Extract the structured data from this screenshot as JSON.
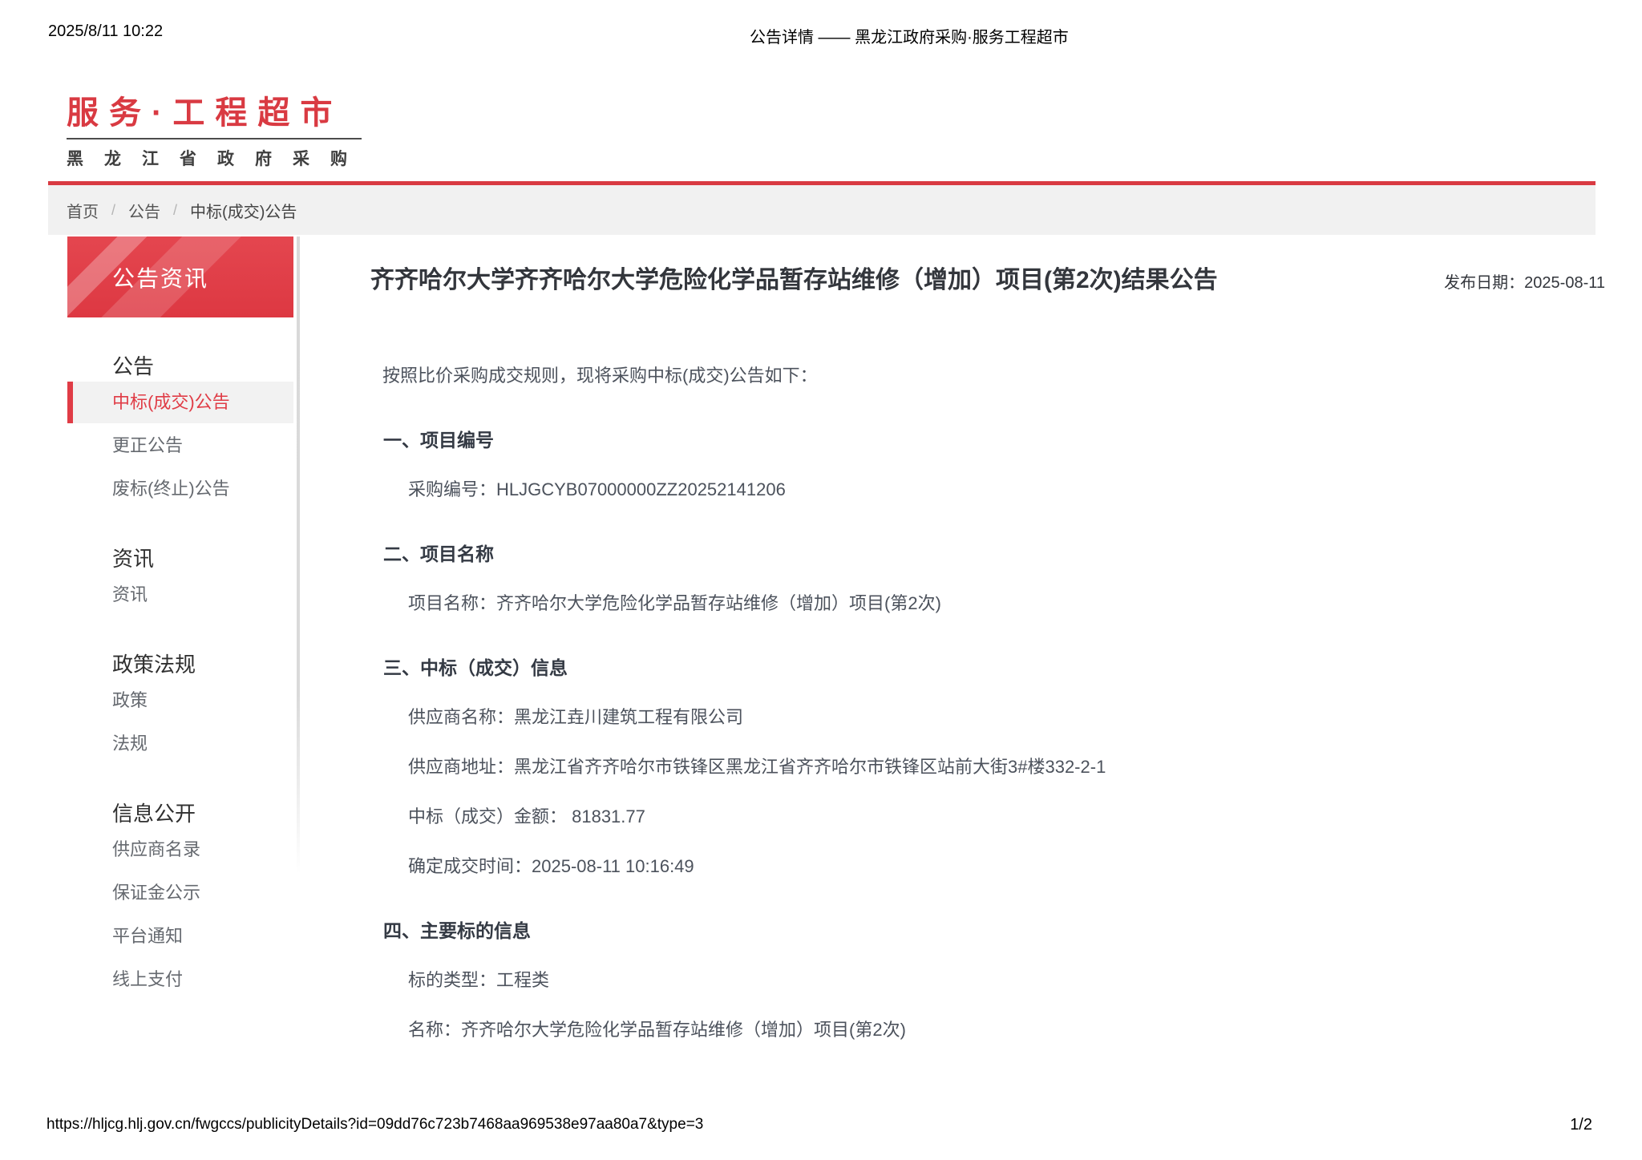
{
  "print_header": {
    "datetime": "2025/8/11 10:22",
    "doc_title": "公告详情 —— 黑龙江政府采购·服务工程超市"
  },
  "logo": {
    "main": "服务·工程超市",
    "sub": "黑龙江省政府采购"
  },
  "breadcrumb": {
    "separator": "/",
    "items": [
      "首页",
      "公告",
      "中标(成交)公告"
    ]
  },
  "sidebar": {
    "banner": "公告资讯",
    "groups": [
      {
        "heading": "公告",
        "items": [
          {
            "label": "中标(成交)公告",
            "active": true
          },
          {
            "label": "更正公告"
          },
          {
            "label": "废标(终止)公告"
          }
        ]
      },
      {
        "heading": "资讯",
        "items": [
          {
            "label": "资讯"
          }
        ]
      },
      {
        "heading": "政策法规",
        "items": [
          {
            "label": "政策"
          },
          {
            "label": "法规"
          }
        ]
      },
      {
        "heading": "信息公开",
        "items": [
          {
            "label": "供应商名录"
          },
          {
            "label": "保证金公示"
          },
          {
            "label": "平台通知"
          },
          {
            "label": "线上支付"
          }
        ]
      }
    ]
  },
  "article": {
    "title": "齐齐哈尔大学齐齐哈尔大学危险化学品暂存站维修（增加）项目(第2次)结果公告",
    "publish_date": "发布日期：2025-08-11",
    "intro": "按照比价采购成交规则，现将采购中标(成交)公告如下：",
    "sections": [
      {
        "heading": "一、项目编号",
        "lines": [
          "采购编号：HLJGCYB07000000ZZ20252141206"
        ]
      },
      {
        "heading": "二、项目名称",
        "lines": [
          "项目名称：齐齐哈尔大学危险化学品暂存站维修（增加）项目(第2次)"
        ]
      },
      {
        "heading": "三、中标（成交）信息",
        "lines": [
          "供应商名称：黑龙江垚川建筑工程有限公司",
          "供应商地址：黑龙江省齐齐哈尔市铁锋区黑龙江省齐齐哈尔市铁锋区站前大街3#楼332-2-1",
          "中标（成交）金额： 81831.77",
          "确定成交时间：2025-08-11 10:16:49"
        ]
      },
      {
        "heading": "四、主要标的信息",
        "lines": [
          "标的类型：工程类",
          "名称：齐齐哈尔大学危险化学品暂存站维修（增加）项目(第2次)"
        ]
      }
    ]
  },
  "print_footer": {
    "url": "https://hljcg.hlj.gov.cn/fwgccs/publicityDetails?id=09dd76c723b7468aa969538e97aa80a7&type=3",
    "page": "1/2"
  },
  "colors": {
    "brand_red": "#d93a42",
    "banner_red": "#e2424c",
    "active_red": "#e03c46",
    "breadcrumb_bg": "#f1f1f1",
    "body_text": "#4c525c",
    "heading_text": "#343a44"
  }
}
